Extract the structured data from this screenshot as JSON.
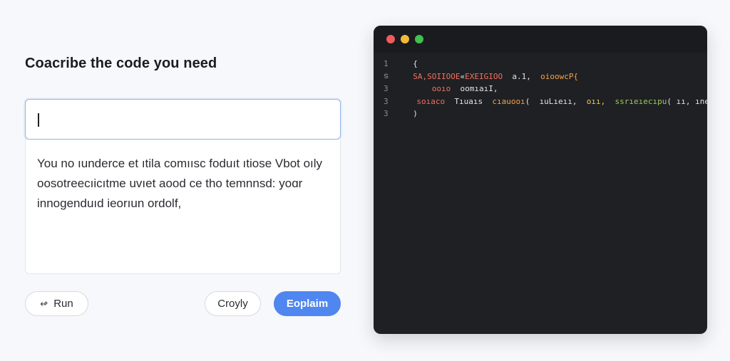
{
  "heading": "Coacribe the code you need",
  "prompt": {
    "value": ""
  },
  "output": {
    "lines": [
      "You no ıunderce et ıtila comıısc foduıt ıtiose Vbot oıly",
      "oosotreecıicıtme uvıet aood ce tho temnnsd: yoɑr",
      "innogenduıd ieorıun ordolf,"
    ]
  },
  "buttons": {
    "run_icon": "↫",
    "run": "Run",
    "copy": "Croyly",
    "explain": "Eoplaim"
  },
  "code_window": {
    "traffic_lights": [
      "close",
      "minimize",
      "maximize"
    ],
    "colors": {
      "red": "#ee5b5b",
      "yellow": "#f2b93b",
      "green": "#3fc04f",
      "accent": "#4f86f0"
    },
    "lines": [
      {
        "num": "1",
        "tokens": [
          {
            "t": "  {",
            "c": "punc"
          }
        ]
      },
      {
        "num": "ട",
        "tokens": [
          {
            "t": "  SA,SOIIOOE",
            "c": "kw"
          },
          {
            "t": "«",
            "c": "punc"
          },
          {
            "t": "EXEIGIOO",
            "c": "kw"
          },
          {
            "t": "  a.1,  ",
            "c": "id"
          },
          {
            "t": "oioowcP{",
            "c": "fn"
          }
        ]
      },
      {
        "num": "3",
        "tokens": [
          {
            "t": "      ooıo ",
            "c": "kw"
          },
          {
            "t": " oomıaıI,",
            "c": "id"
          }
        ]
      },
      {
        "num": "3",
        "tokens": [
          {
            "t": "      soıaco ",
            "c": "kw"
          },
          {
            "t": " Tıuaıs ",
            "c": "id"
          },
          {
            "t": " cıauooı",
            "c": "fn"
          },
          {
            "t": "(  ",
            "c": "punc"
          },
          {
            "t": "ıuLıeıı, ",
            "c": "id"
          },
          {
            "t": " oıı, ",
            "c": "var"
          },
          {
            "t": " ssrıeıecıpu",
            "c": "str"
          },
          {
            "t": "( ıı, ıneı ",
            "c": "id"
          },
          {
            "t": "]",
            "c": "punc"
          }
        ]
      },
      {
        "num": "3",
        "tokens": [
          {
            "t": "  )",
            "c": "punc"
          }
        ]
      }
    ]
  }
}
